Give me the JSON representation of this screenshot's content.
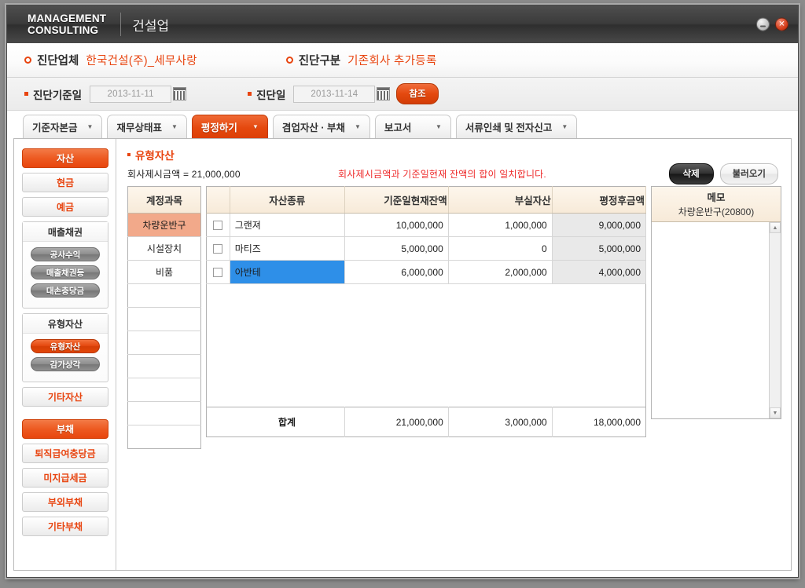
{
  "titlebar": {
    "brand": "MANAGEMENT\nCONSULTING",
    "app_subtitle": "건설업",
    "minimize_label": "minimize",
    "close_label": "✕"
  },
  "info_bar": {
    "company_label": "진단업체",
    "company_value": "한국건설(주)_세무사랑",
    "type_label": "진단구분",
    "type_value": "기존회사  추가등록"
  },
  "date_bar": {
    "base_date_label": "진단기준일",
    "base_date_value": "2013-11-11",
    "diag_date_label": "진단일",
    "diag_date_value": "2013-11-14",
    "refer_button": "참조"
  },
  "tabs": [
    {
      "label": "기준자본금",
      "caret": "▼",
      "active": false
    },
    {
      "label": "재무상태표",
      "caret": "▼",
      "active": false
    },
    {
      "label": "평정하기",
      "caret": "▼",
      "active": true
    },
    {
      "label": "겸업자산 · 부채",
      "caret": "▼",
      "active": false
    },
    {
      "label": "보고서",
      "caret": "▼",
      "active": false
    },
    {
      "label": "서류인쇄 및 전자신고",
      "caret": "▼",
      "active": false
    }
  ],
  "sidebar": {
    "assets_header": "자산",
    "items_top": [
      {
        "label": "현금"
      },
      {
        "label": "예금"
      }
    ],
    "receivables_group": {
      "title": "매출채권",
      "chips": [
        {
          "label": "공사수익",
          "selected": false
        },
        {
          "label": "매출채권등",
          "selected": false
        },
        {
          "label": "대손충당금",
          "selected": false
        }
      ]
    },
    "tangible_group": {
      "title": "유형자산",
      "chips": [
        {
          "label": "유형자산",
          "selected": true
        },
        {
          "label": "감가상각",
          "selected": false
        }
      ]
    },
    "other_assets": "기타자산",
    "liabilities_header": "부채",
    "liability_items": [
      {
        "label": "퇴직급여충당금"
      },
      {
        "label": "미지급세금"
      },
      {
        "label": "부외부채"
      },
      {
        "label": "기타부채"
      }
    ]
  },
  "main": {
    "section_title": "유형자산",
    "summary_label": "회사제시금액  =  21,000,000",
    "warning_text": "회사제시금액과 기준일현재 잔액의 합이 일치합니다.",
    "delete_button": "삭제",
    "load_button": "불러오기",
    "account_column_header": "계정과목",
    "account_rows": [
      {
        "label": "차량운반구",
        "selected": true
      },
      {
        "label": "시설장치",
        "selected": false
      },
      {
        "label": "비품",
        "selected": false
      },
      {
        "label": "",
        "selected": false
      },
      {
        "label": "",
        "selected": false
      },
      {
        "label": "",
        "selected": false
      },
      {
        "label": "",
        "selected": false
      },
      {
        "label": "",
        "selected": false
      },
      {
        "label": "",
        "selected": false
      },
      {
        "label": "",
        "selected": false
      }
    ],
    "table_headers": {
      "checkbox": "",
      "kind": "자산종류",
      "balance": "기준일현재잔액",
      "bad_asset": "부실자산",
      "after_amount": "평정후금액"
    },
    "table_rows": [
      {
        "checked": false,
        "kind": "그랜져",
        "balance": "10,000,000",
        "bad_asset": "1,000,000",
        "after_amount": "9,000,000",
        "selected": false
      },
      {
        "checked": false,
        "kind": "마티즈",
        "balance": "5,000,000",
        "bad_asset": "0",
        "after_amount": "5,000,000",
        "selected": false
      },
      {
        "checked": false,
        "kind": "아반테",
        "balance": "6,000,000",
        "bad_asset": "2,000,000",
        "after_amount": "4,000,000",
        "selected": true
      }
    ],
    "total_row": {
      "label": "합계",
      "balance": "21,000,000",
      "bad_asset": "3,000,000",
      "after_amount": "18,000,000"
    },
    "memo": {
      "title": "메모",
      "subtitle": "차량운반구(20800)",
      "content": "",
      "scroll_up": "▲",
      "scroll_down": "▼"
    }
  }
}
